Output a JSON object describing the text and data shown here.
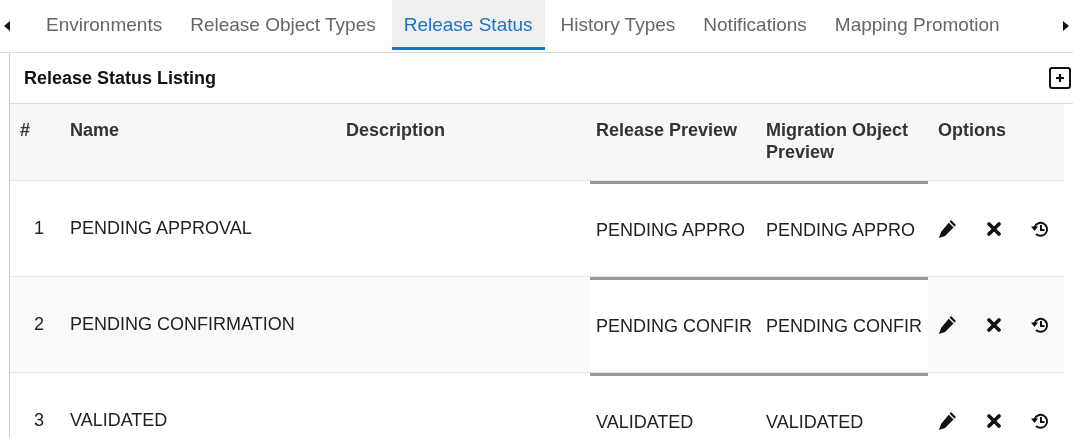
{
  "tabs": [
    {
      "label": "Environments",
      "selected": false
    },
    {
      "label": "Release Object Types",
      "selected": false
    },
    {
      "label": "Release Status",
      "selected": true
    },
    {
      "label": "History Types",
      "selected": false
    },
    {
      "label": "Notifications",
      "selected": false
    },
    {
      "label": "Mapping Promotion",
      "selected": false
    }
  ],
  "panel": {
    "title": "Release Status Listing"
  },
  "table": {
    "columns": [
      "#",
      "Name",
      "Description",
      "Release Preview",
      "Migration Object Preview",
      "Options"
    ],
    "rows": [
      {
        "number": "1",
        "name": "PENDING APPROVAL",
        "release_preview": "PENDING APPRO",
        "migration_preview": "PENDING APPRO"
      },
      {
        "number": "2",
        "name": "PENDING CONFIRMATION",
        "release_preview": "PENDING CONFIR",
        "migration_preview": "PENDING CONFIR"
      },
      {
        "number": "3",
        "name": "VALIDATED",
        "release_preview": "VALIDATED",
        "migration_preview": "VALIDATED"
      }
    ]
  }
}
